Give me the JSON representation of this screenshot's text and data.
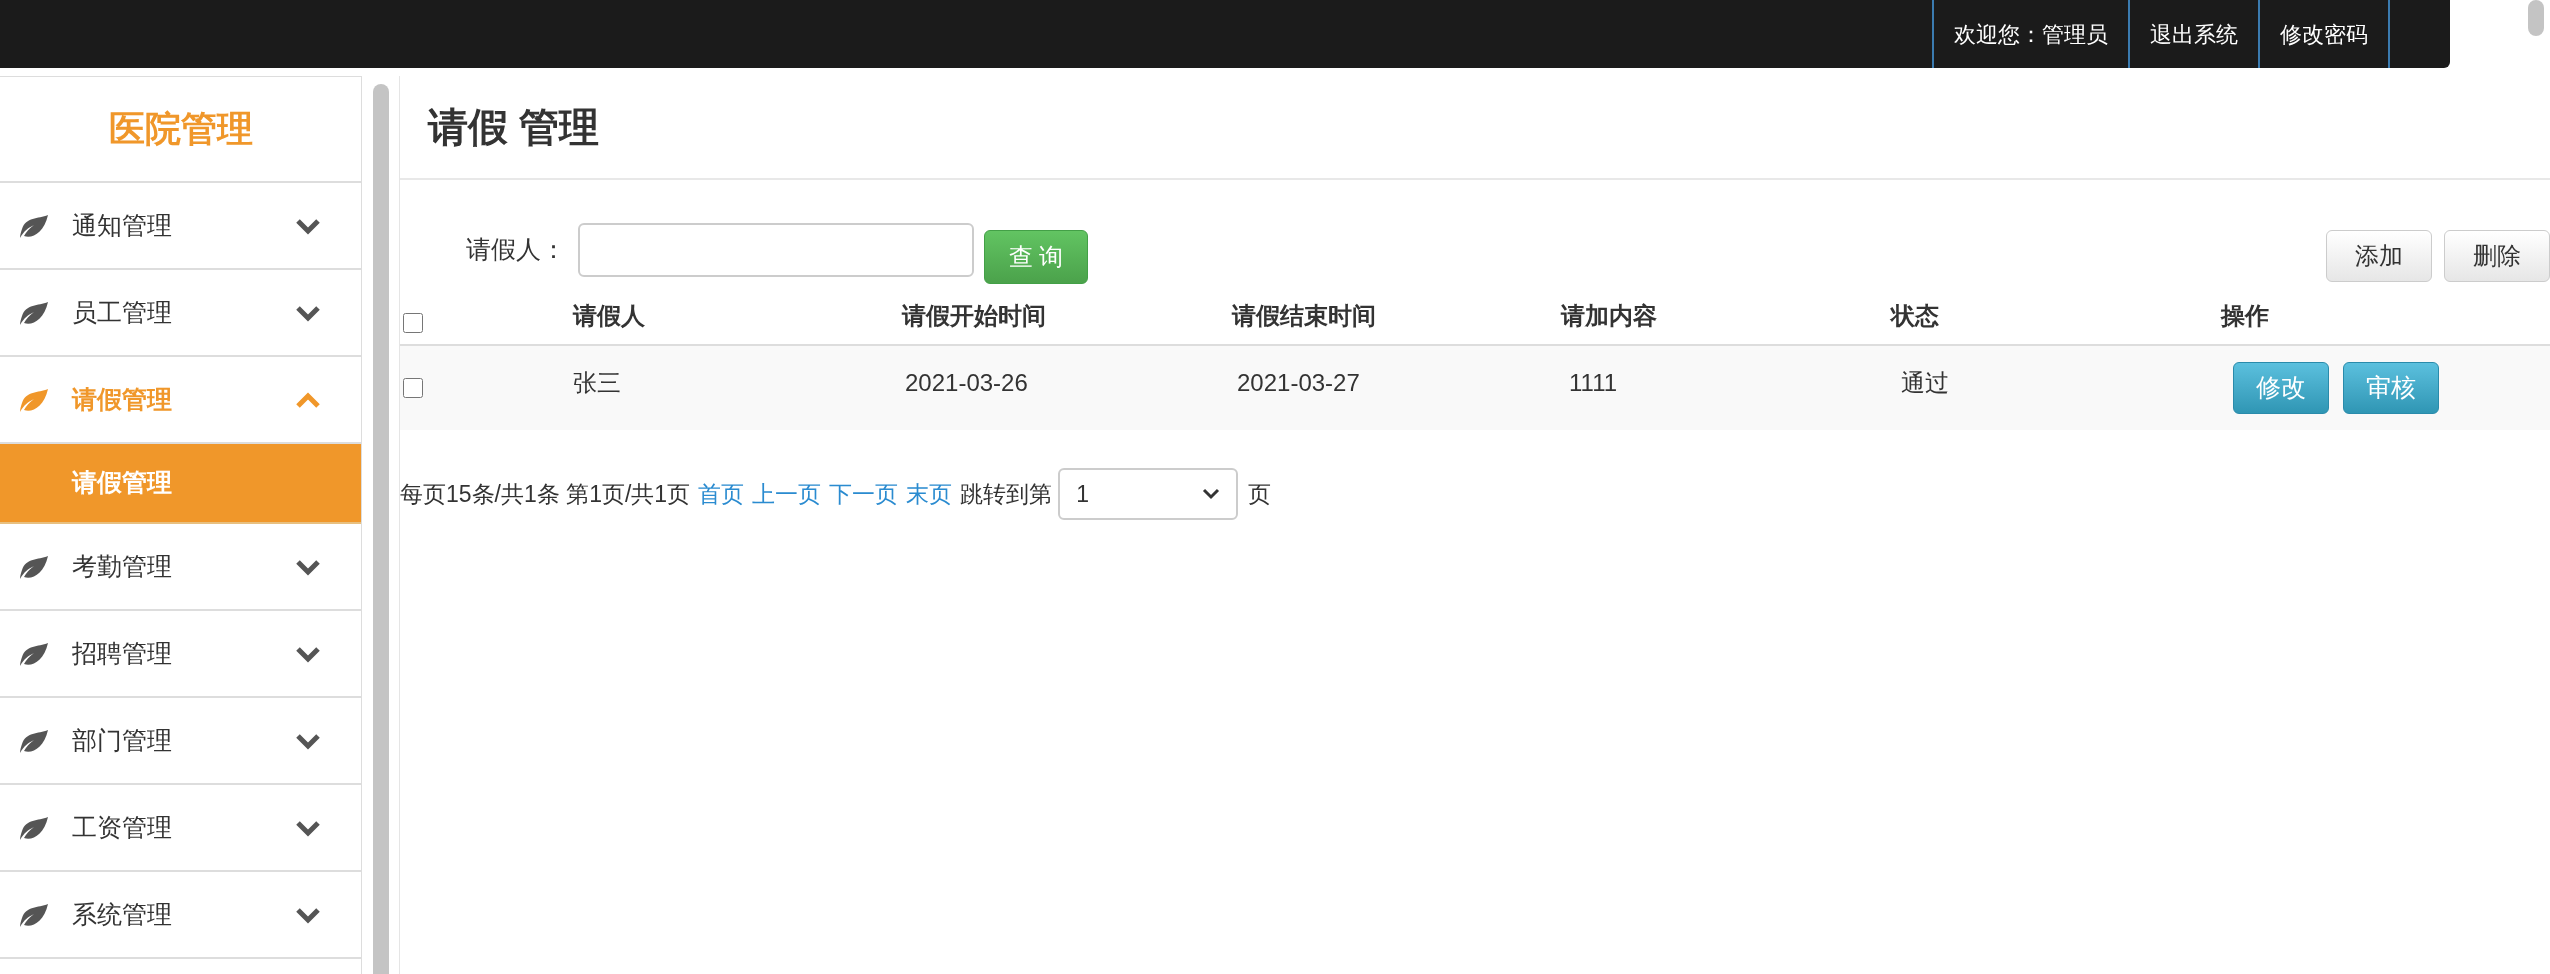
{
  "top_bar": {
    "items": [
      "欢迎您：管理员",
      "退出系统",
      "修改密码"
    ]
  },
  "sidebar": {
    "title": "医院管理",
    "items": [
      {
        "label": "通知管理",
        "expanded": false
      },
      {
        "label": "员工管理",
        "expanded": false
      },
      {
        "label": "请假管理",
        "expanded": true,
        "children": [
          {
            "label": "请假管理",
            "selected": true
          }
        ]
      },
      {
        "label": "考勤管理",
        "expanded": false
      },
      {
        "label": "招聘管理",
        "expanded": false
      },
      {
        "label": "部门管理",
        "expanded": false
      },
      {
        "label": "工资管理",
        "expanded": false
      },
      {
        "label": "系统管理",
        "expanded": false
      }
    ]
  },
  "page_title": "请假 管理",
  "search": {
    "label": "请假人：",
    "button": "查 询"
  },
  "toolbar": [
    "添加",
    "删除"
  ],
  "table": {
    "header_checked": false,
    "columns": [
      "请假人",
      "请假开始时间",
      "请假结束时间",
      "请加内容",
      "状态",
      "操作"
    ],
    "rows": [
      {
        "checked": false,
        "cells": [
          "张三",
          "2021-03-26",
          "2021-03-27",
          "1111",
          "通过"
        ],
        "actions": [
          "修改",
          "审核"
        ]
      }
    ]
  },
  "pagination": {
    "summary": "每页15条/共1条 第1页/共1页",
    "links": [
      "首页",
      "上一页",
      "下一页",
      "末页"
    ],
    "jump_label": "跳转到第",
    "page_value": "1",
    "unit": "页"
  }
}
